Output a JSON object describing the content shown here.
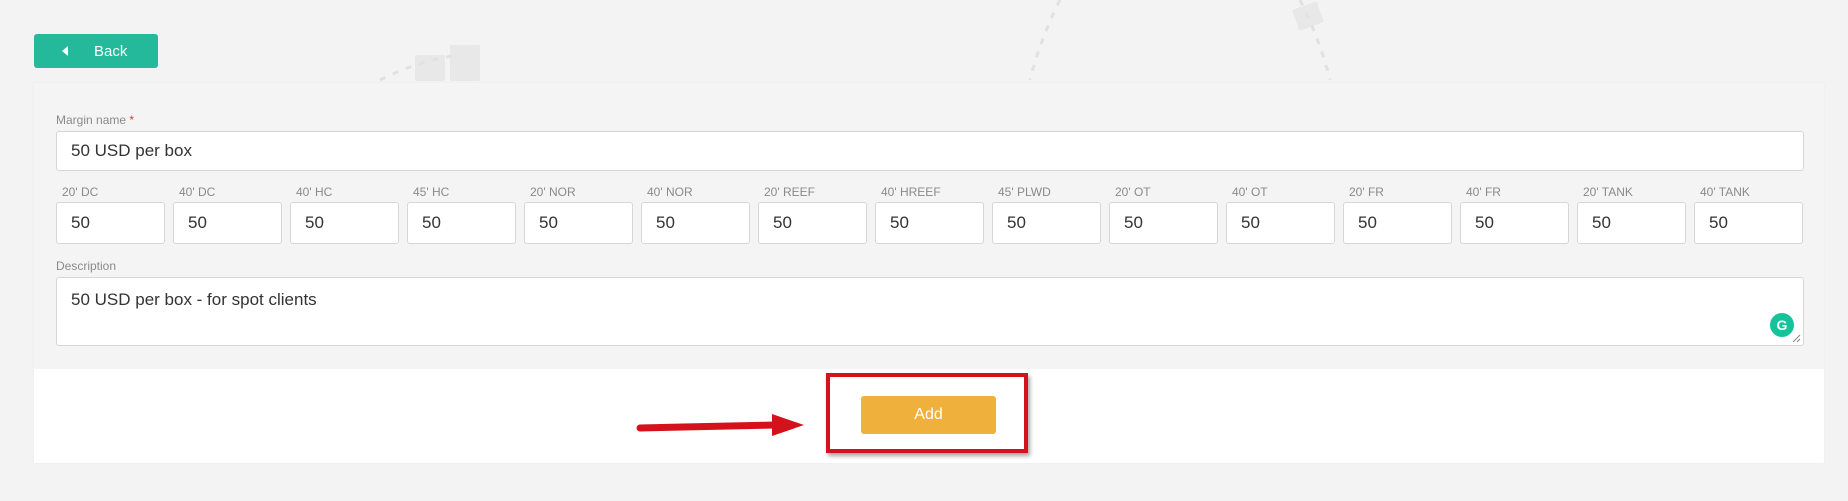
{
  "back_button": {
    "label": "Back"
  },
  "margin_name": {
    "label": "Margin name",
    "required_mark": "*",
    "value": "50 USD per box"
  },
  "containers": [
    {
      "label": "20' DC",
      "value": "50"
    },
    {
      "label": "40' DC",
      "value": "50"
    },
    {
      "label": "40' HC",
      "value": "50"
    },
    {
      "label": "45' HC",
      "value": "50"
    },
    {
      "label": "20' NOR",
      "value": "50"
    },
    {
      "label": "40' NOR",
      "value": "50"
    },
    {
      "label": "20' REEF",
      "value": "50"
    },
    {
      "label": "40' HREEF",
      "value": "50"
    },
    {
      "label": "45' PLWD",
      "value": "50"
    },
    {
      "label": "20' OT",
      "value": "50"
    },
    {
      "label": "40' OT",
      "value": "50"
    },
    {
      "label": "20' FR",
      "value": "50"
    },
    {
      "label": "40' FR",
      "value": "50"
    },
    {
      "label": "20' TANK",
      "value": "50"
    },
    {
      "label": "40' TANK",
      "value": "50"
    }
  ],
  "description": {
    "label": "Description",
    "value": "50 USD per box - for spot clients"
  },
  "add_button": {
    "label": "Add"
  },
  "grammarly_badge": {
    "icon": "grammarly-icon",
    "glyph": "G"
  },
  "colors": {
    "primary_green": "#23b99a",
    "add_orange": "#f0b13c",
    "annotation_red": "#d4121b"
  }
}
